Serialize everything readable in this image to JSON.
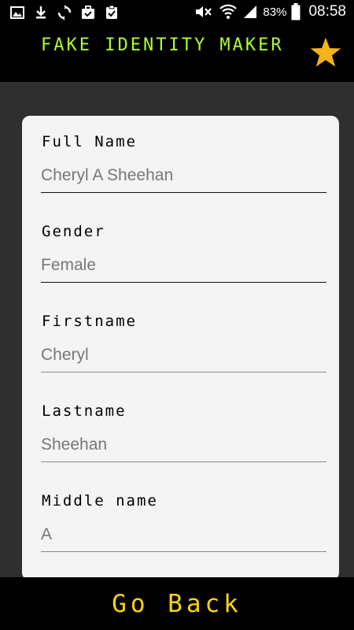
{
  "status_bar": {
    "battery": "83%",
    "time": "08:58",
    "icons": [
      "image-icon",
      "download-icon",
      "sync-icon",
      "briefcase-check-icon",
      "clipboard-check-icon",
      "mute-icon",
      "wifi-icon",
      "signal-icon",
      "battery-icon"
    ]
  },
  "header": {
    "title": "FAKE IDENTITY MAKER",
    "title_color": "#adff2f",
    "favorite_icon": "star-icon",
    "favorite_color": "#f5b31a"
  },
  "fields": [
    {
      "label": "Full Name",
      "value": "Cheryl A Sheehan"
    },
    {
      "label": "Gender",
      "value": "Female"
    },
    {
      "label": "Firstname",
      "value": "Cheryl"
    },
    {
      "label": "Lastname",
      "value": "Sheehan"
    },
    {
      "label": "Middle name",
      "value": "A"
    }
  ],
  "footer": {
    "go_back_label": "Go Back",
    "go_back_color": "#ffd700"
  }
}
